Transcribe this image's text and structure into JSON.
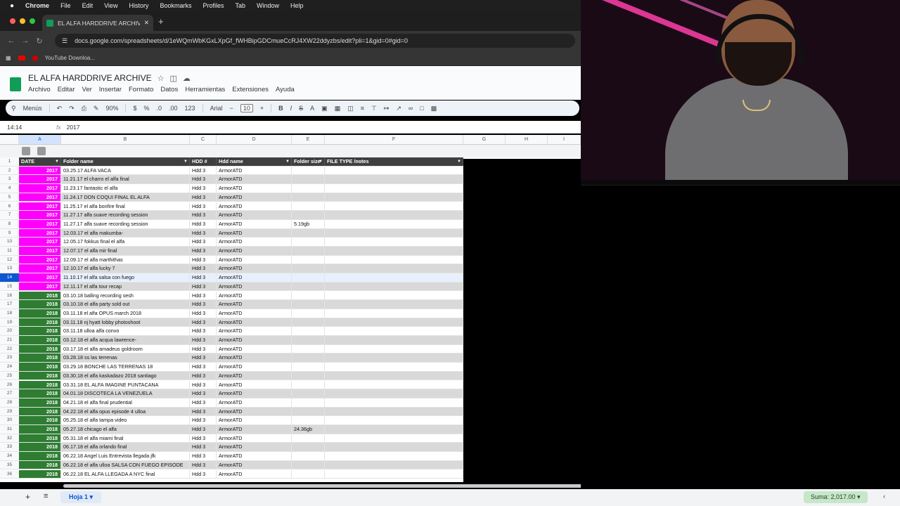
{
  "menubar": {
    "app": "Chrome",
    "items": [
      "File",
      "Edit",
      "View",
      "History",
      "Bookmarks",
      "Profiles",
      "Tab",
      "Window",
      "Help"
    ]
  },
  "browser": {
    "tab_title": "EL ALFA HARDDRIVE ARCHIVE",
    "url": "docs.google.com/spreadsheets/d/1eWQmWbKGxLXpGf_fWHBipGDCmueCcRJ4XW22ddyzbs/edit?pli=1&gid=0#gid=0",
    "bookmark": "YouTube Downloa..."
  },
  "doc": {
    "title": "EL ALFA HARDDRIVE ARCHIVE",
    "menus": [
      "Archivo",
      "Editar",
      "Ver",
      "Insertar",
      "Formato",
      "Datos",
      "Herramientas",
      "Extensiones",
      "Ayuda"
    ]
  },
  "toolbar": {
    "search": "Menús",
    "zoom": "90%",
    "currency": "$",
    "percent": "%",
    "dec_less": ".0",
    "dec_more": ".00",
    "num_format": "123",
    "font": "Arial",
    "font_size": "10",
    "bold": "B",
    "italic": "I",
    "strike": "S",
    "text_color": "A"
  },
  "formula": {
    "cell_ref": "14:14",
    "value": "2017"
  },
  "columns": [
    "A",
    "B",
    "C",
    "D",
    "E",
    "F",
    "G",
    "H",
    "I"
  ],
  "header_row": {
    "date": "DATE",
    "folder": "Folder name",
    "hdd_num": "HDD #",
    "hdd_name": "Hdd name",
    "folder_size": "Folder size",
    "file_type": "FILE TYPE /notes"
  },
  "colors": {
    "y2017": "#ff00ff",
    "y2018": "#2e7d32",
    "header": "#3f3f3f",
    "sum_chip": "#c8e6c9"
  },
  "rows": [
    {
      "n": "2",
      "year": "2017",
      "folder": "03.25.17 ALFA VACA",
      "hdd": "Hdd 3",
      "name": "ArmorATD",
      "size": ""
    },
    {
      "n": "3",
      "year": "2017",
      "folder": "11.21.17 el charro el alfa final",
      "hdd": "Hdd 3",
      "name": "ArmorATD",
      "size": ""
    },
    {
      "n": "4",
      "year": "2017",
      "folder": "11.23.17 fantastic el alfa",
      "hdd": "Hdd 3",
      "name": "ArmorATD",
      "size": ""
    },
    {
      "n": "5",
      "year": "2017",
      "folder": "11.24.17 DON COQUI FINAL EL ALFA",
      "hdd": "Hdd 3",
      "name": "ArmorATD",
      "size": ""
    },
    {
      "n": "6",
      "year": "2017",
      "folder": "11.25.17 el alfa bonfire final",
      "hdd": "Hdd 3",
      "name": "ArmorATD",
      "size": ""
    },
    {
      "n": "7",
      "year": "2017",
      "folder": "11.27.17 alfa suave recording session",
      "hdd": "Hdd 3",
      "name": "ArmorATD",
      "size": ""
    },
    {
      "n": "8",
      "year": "2017",
      "folder": "11.27.17 alfa suave recording session",
      "hdd": "Hdd 3",
      "name": "ArmorATD",
      "size": "5.19gb"
    },
    {
      "n": "9",
      "year": "2017",
      "folder": "12.03.17 el alfa makumba-",
      "hdd": "Hdd 3",
      "name": "ArmorATD",
      "size": ""
    },
    {
      "n": "10",
      "year": "2017",
      "folder": "12.05.17 fokkus final el alfa",
      "hdd": "Hdd 3",
      "name": "ArmorATD",
      "size": ""
    },
    {
      "n": "11",
      "year": "2017",
      "folder": "12.07.17 el alfa mir final",
      "hdd": "Hdd 3",
      "name": "ArmorATD",
      "size": ""
    },
    {
      "n": "12",
      "year": "2017",
      "folder": "12.09.17 el alfa marthithas",
      "hdd": "Hdd 3",
      "name": "ArmorATD",
      "size": ""
    },
    {
      "n": "13",
      "year": "2017",
      "folder": "12.10.17 el alfa lucky 7",
      "hdd": "Hdd 3",
      "name": "ArmorATD",
      "size": ""
    },
    {
      "n": "14",
      "year": "2017",
      "folder": "11.10.17 el alfa salsa con fuego",
      "hdd": "Hdd 3",
      "name": "ArmorATD",
      "size": ""
    },
    {
      "n": "15",
      "year": "2017",
      "folder": "12.11.17 el alfa tour recap",
      "hdd": "Hdd 3",
      "name": "ArmorATD",
      "size": ""
    },
    {
      "n": "16",
      "year": "2018",
      "folder": "03.10.18 balling recording sesh",
      "hdd": "Hdd 3",
      "name": "ArmorATD",
      "size": ""
    },
    {
      "n": "17",
      "year": "2018",
      "folder": "03.10.18 el alfa party sold out",
      "hdd": "Hdd 3",
      "name": "ArmorATD",
      "size": ""
    },
    {
      "n": "18",
      "year": "2018",
      "folder": "03.11.18 el alfa OPUS march 2018",
      "hdd": "Hdd 3",
      "name": "ArmorATD",
      "size": ""
    },
    {
      "n": "19",
      "year": "2018",
      "folder": "03.11.18 nj hyatt lobby photoshoot",
      "hdd": "Hdd 3",
      "name": "ArmorATD",
      "size": ""
    },
    {
      "n": "20",
      "year": "2018",
      "folder": "03.11.18 ulloa alfa convo",
      "hdd": "Hdd 3",
      "name": "ArmorATD",
      "size": ""
    },
    {
      "n": "21",
      "year": "2018",
      "folder": "03.12.18 el alfa acqua lawrence-",
      "hdd": "Hdd 3",
      "name": "ArmorATD",
      "size": ""
    },
    {
      "n": "22",
      "year": "2018",
      "folder": "03.17.18 el alfa amadeus goldroom",
      "hdd": "Hdd 3",
      "name": "ArmorATD",
      "size": ""
    },
    {
      "n": "23",
      "year": "2018",
      "folder": "03.28.18 ss las terrenas",
      "hdd": "Hdd 3",
      "name": "ArmorATD",
      "size": ""
    },
    {
      "n": "24",
      "year": "2018",
      "folder": "03.29.18 BONCHE LAS TERRENAS 18",
      "hdd": "Hdd 3",
      "name": "ArmorATD",
      "size": ""
    },
    {
      "n": "25",
      "year": "2018",
      "folder": "03.30.18 el alfa kaskadazo 2018 santiago",
      "hdd": "Hdd 3",
      "name": "ArmorATD",
      "size": ""
    },
    {
      "n": "26",
      "year": "2018",
      "folder": "03.31.18 EL ALFA IMAGINE PUNTACANA",
      "hdd": "Hdd 3",
      "name": "ArmorATD",
      "size": ""
    },
    {
      "n": "27",
      "year": "2018",
      "folder": "04.01.18 DISCOTECA LA VENEZUELA",
      "hdd": "Hdd 3",
      "name": "ArmorATD",
      "size": ""
    },
    {
      "n": "28",
      "year": "2018",
      "folder": "04.21.18 el alfa final prudential",
      "hdd": "Hdd 3",
      "name": "ArmorATD",
      "size": ""
    },
    {
      "n": "29",
      "year": "2018",
      "folder": "04.22.18 el alfa opus episode 4 ulloa",
      "hdd": "Hdd 3",
      "name": "ArmorATD",
      "size": ""
    },
    {
      "n": "30",
      "year": "2018",
      "folder": "05.25.18 el alfa tampa video",
      "hdd": "Hdd 3",
      "name": "ArmorATD",
      "size": ""
    },
    {
      "n": "31",
      "year": "2018",
      "folder": "05.27.18 chicago el alfa",
      "hdd": "Hdd 3",
      "name": "ArmorATD",
      "size": "24.36gb"
    },
    {
      "n": "32",
      "year": "2018",
      "folder": "05.31.18 el alfa miami final",
      "hdd": "Hdd 3",
      "name": "ArmorATD",
      "size": ""
    },
    {
      "n": "33",
      "year": "2018",
      "folder": "06.17.18 el alfa orlando final",
      "hdd": "Hdd 3",
      "name": "ArmorATD",
      "size": ""
    },
    {
      "n": "34",
      "year": "2018",
      "folder": "06.22.18 Angel Luis Entrevista llegada jfk",
      "hdd": "Hdd 3",
      "name": "ArmorATD",
      "size": ""
    },
    {
      "n": "35",
      "year": "2018",
      "folder": "06.22.18 el alfa ulloa SALSA CON FUEGO EPISODE",
      "hdd": "Hdd 3",
      "name": "ArmorATD",
      "size": ""
    },
    {
      "n": "36",
      "year": "2018",
      "folder": "06.22.18 EL ALFA LLEGADA A NYC final",
      "hdd": "Hdd 3",
      "name": "ArmorATD",
      "size": ""
    }
  ],
  "selected_row": "14",
  "footer": {
    "sheet_name": "Hoja 1",
    "sum": "Suma: 2,017.00"
  }
}
